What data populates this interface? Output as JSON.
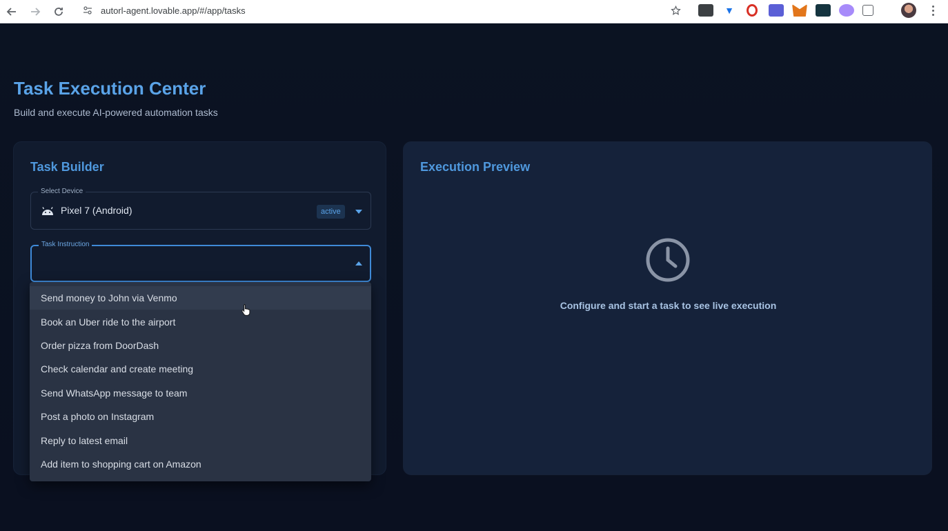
{
  "browser": {
    "url": "autorl-agent.lovable.app/#/app/tasks"
  },
  "header": {
    "title": "Task Execution Center",
    "subtitle": "Build and execute AI-powered automation tasks"
  },
  "task_builder": {
    "title": "Task Builder",
    "device_label": "Select Device",
    "device_value": "Pixel 7 (Android)",
    "device_status": "active",
    "instruction_label": "Task Instruction",
    "instruction_value": "",
    "options": [
      "Send money to John via Venmo",
      "Book an Uber ride to the airport",
      "Order pizza from DoorDash",
      "Check calendar and create meeting",
      "Send WhatsApp message to team",
      "Post a photo on Instagram",
      "Reply to latest email",
      "Add item to shopping cart on Amazon"
    ]
  },
  "execution_preview": {
    "title": "Execution Preview",
    "empty_message": "Configure and start a task to see live execution"
  },
  "colors": {
    "accent": "#4f98dd",
    "background": "#0a1020",
    "panel": "#111b2e"
  },
  "icons": {
    "device": "android-icon",
    "preview": "clock-icon"
  }
}
